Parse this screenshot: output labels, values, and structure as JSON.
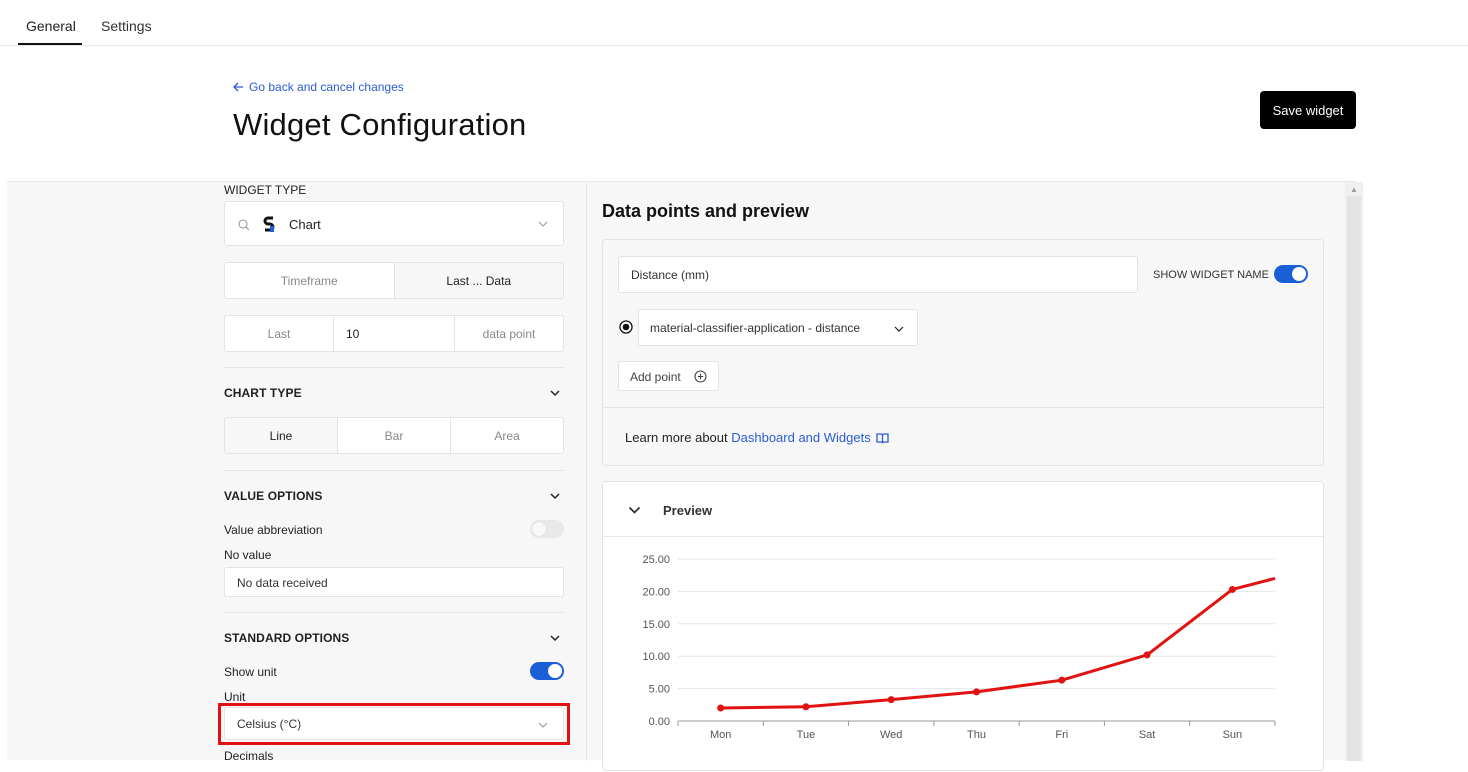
{
  "tabs": [
    {
      "label": "General",
      "active": true
    },
    {
      "label": "Settings",
      "active": false
    }
  ],
  "header": {
    "back_label": "Go back and cancel changes",
    "title": "Widget Configuration",
    "save_label": "Save widget"
  },
  "left": {
    "widget_type": {
      "label": "WIDGET TYPE",
      "value": "Chart"
    },
    "range_mode": {
      "options": [
        "Timeframe",
        "Last ... Data"
      ],
      "selected": "Last ... Data"
    },
    "last_points": {
      "prefix": "Last",
      "value": "10",
      "suffix": "data point"
    },
    "chart_type": {
      "label": "CHART TYPE",
      "options": [
        "Line",
        "Bar",
        "Area"
      ],
      "selected": "Line"
    },
    "value_options": {
      "label": "VALUE OPTIONS",
      "abbreviation_label": "Value abbreviation",
      "abbreviation_on": false,
      "no_value_label": "No value",
      "no_value_text": "No data received"
    },
    "standard_options": {
      "label": "STANDARD OPTIONS",
      "show_unit_label": "Show unit",
      "show_unit_on": true,
      "unit_label": "Unit",
      "unit_value": "Celsius (°C)",
      "decimals_label": "Decimals"
    }
  },
  "right": {
    "title": "Data points and preview",
    "widget_name": "Distance (mm)",
    "show_widget_name_label": "SHOW WIDGET NAME",
    "show_widget_name_on": true,
    "data_point": "material-classifier-application - distance",
    "add_point_label": "Add point",
    "learn_more_prefix": "Learn more about ",
    "learn_more_link": "Dashboard and Widgets",
    "preview_label": "Preview"
  },
  "colors": {
    "accent": "#1a5fd6",
    "link": "#2a5bd7",
    "series": "#e21212",
    "highlight": "#e21212"
  },
  "chart_data": {
    "type": "line",
    "categories": [
      "Mon",
      "Tue",
      "Wed",
      "Thu",
      "Fri",
      "Sat",
      "Sun"
    ],
    "values": [
      2.0,
      2.2,
      3.3,
      4.5,
      6.3,
      10.2,
      20.3
    ],
    "tail_value": 22.0,
    "ylim": [
      0,
      25
    ],
    "yticks": [
      "0.00",
      "5.00",
      "10.00",
      "15.00",
      "20.00",
      "25.00"
    ],
    "grid": true
  }
}
